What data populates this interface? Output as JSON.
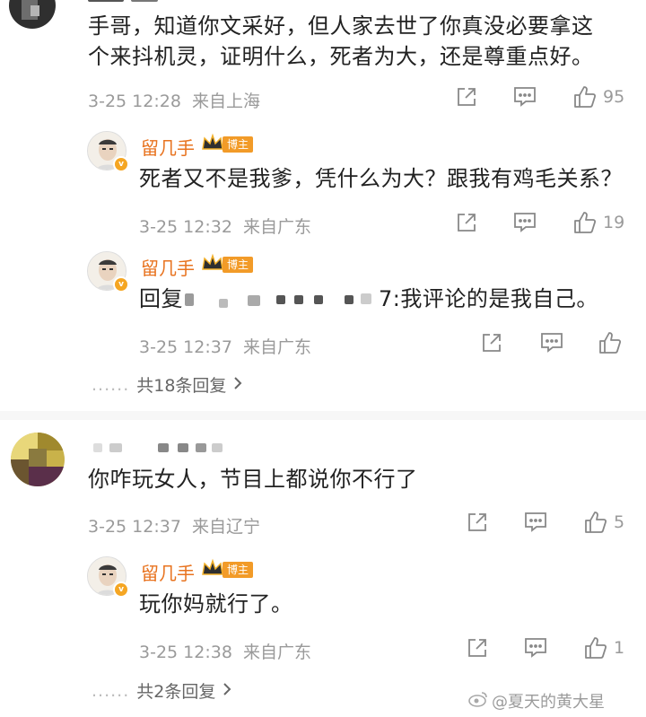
{
  "comments": [
    {
      "text": "手哥，知道你文采好，但人家去世了你真没必要拿这个来抖机灵，证明什么，死者为大，还是尊重点好。",
      "line1": "手哥，知道你文采好，但人家去世了你真没必要拿这",
      "line2": "个来抖机灵，证明什么，死者为大，还是尊重点好。",
      "time": "3-25 12:28",
      "location": "来自上海",
      "likes": "95",
      "replies": [
        {
          "author": "留几手",
          "badge": "博主",
          "text": "死者又不是我爹，凭什么为大？跟我有鸡毛关系？",
          "time": "3-25 12:32",
          "location": "来自广东",
          "likes": "19"
        },
        {
          "author": "留几手",
          "badge": "博主",
          "text_prefix": "回复",
          "text_suffix": "7:我评论的是我自己。",
          "time": "3-25 12:37",
          "location": "来自广东",
          "likes": ""
        }
      ],
      "more_replies": "共18条回复"
    },
    {
      "text": "你咋玩女人，节目上都说你不行了",
      "time": "3-25 12:37",
      "location": "来自辽宁",
      "likes": "5",
      "replies": [
        {
          "author": "留几手",
          "badge": "博主",
          "text": "玩你妈就行了。",
          "time": "3-25 12:38",
          "location": "来自广东",
          "likes": "1"
        }
      ],
      "more_replies": "共2条回复"
    }
  ],
  "watermark": "@夏天的黄大星",
  "icons": {
    "share": "share-icon",
    "comment": "comment-icon",
    "like": "thumbs-up-icon",
    "more": "chevron-right-icon"
  },
  "colors": {
    "author": "#e8731f",
    "badge": "#f29b28",
    "meta": "#9a9a9a"
  }
}
